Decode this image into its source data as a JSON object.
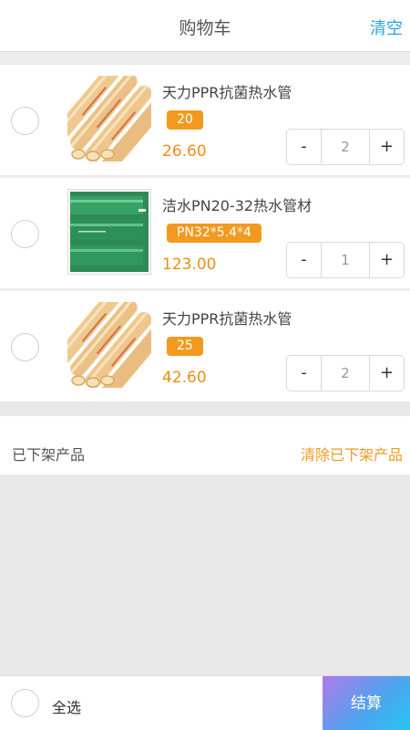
{
  "header": {
    "title": "购物车",
    "clear_label": "清空"
  },
  "cart": {
    "items": [
      {
        "name": "天力PPR抗菌热水管",
        "spec": "20",
        "price": "26.60",
        "quantity": "2",
        "image": "beige-ppr-pipes"
      },
      {
        "name": "洁水PN20-32热水管材",
        "spec": "PN32*5.4*4",
        "price": "123.00",
        "quantity": "1",
        "image": "green-ppr-pipes"
      },
      {
        "name": "天力PPR抗菌热水管",
        "spec": "25",
        "price": "42.60",
        "quantity": "2",
        "image": "beige-ppr-pipes"
      }
    ],
    "minus_label": "-",
    "plus_label": "+"
  },
  "offline": {
    "label": "已下架产品",
    "clear_label": "清除已下架产品"
  },
  "footer": {
    "select_all_label": "全选",
    "checkout_label": "结算"
  },
  "colors": {
    "accent": "#f29a1f",
    "price": "#ee8d17",
    "link": "#2aa3e6"
  }
}
